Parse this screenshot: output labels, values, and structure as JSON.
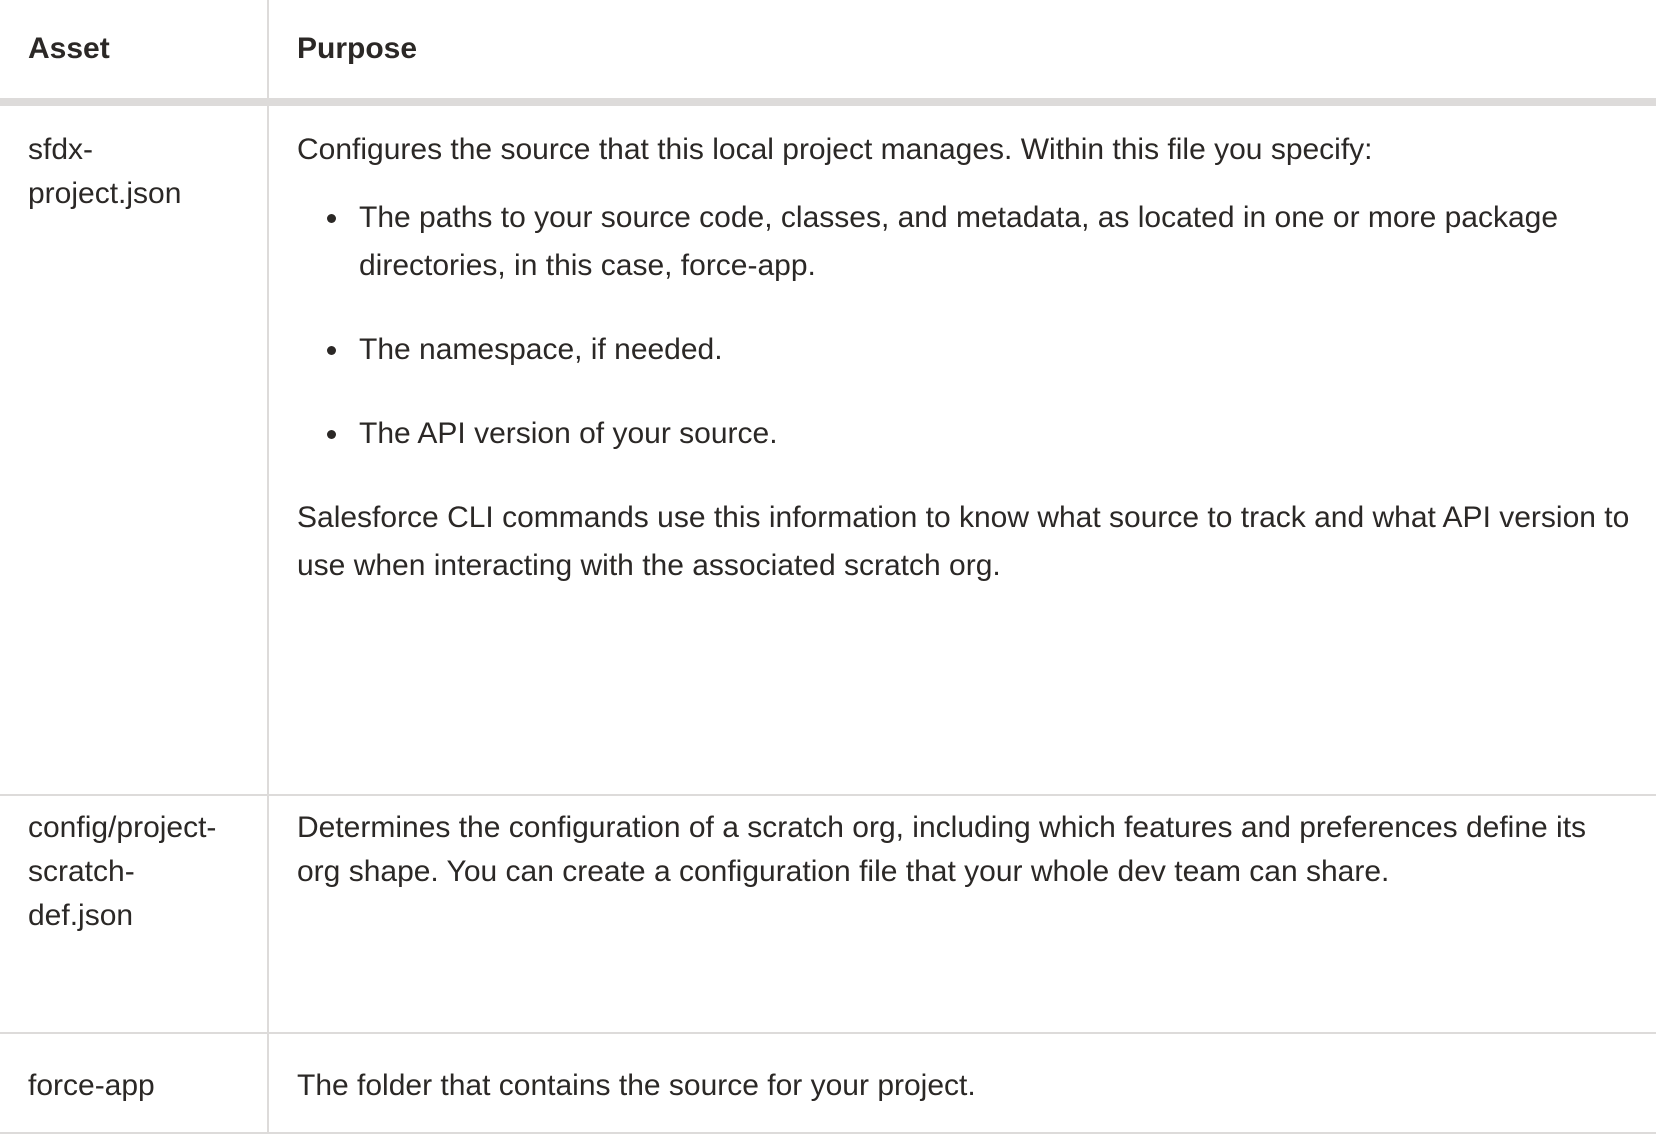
{
  "table": {
    "headers": {
      "asset": "Asset",
      "purpose": "Purpose"
    },
    "rows": [
      {
        "asset": "sfdx-\nproject.json",
        "purpose_intro": "Configures the source that this local project manages. Within this file you specify:",
        "bullets": [
          "The paths to your source code, classes, and metadata, as located in one or more package directories, in this case, force-app.",
          "The namespace, if needed.",
          "The API version of your source."
        ],
        "purpose_summary": "Salesforce CLI commands use this information to know what source to track and what API version to use when interacting with the associated scratch org."
      },
      {
        "asset": "config/project-\nscratch-\ndef.json",
        "purpose": "Determines the configuration of a scratch org, including which features and preferences define its org shape. You can create a configuration file that your whole dev team can share."
      },
      {
        "asset": "force-app",
        "purpose": "The folder that contains the source for your project."
      }
    ]
  }
}
